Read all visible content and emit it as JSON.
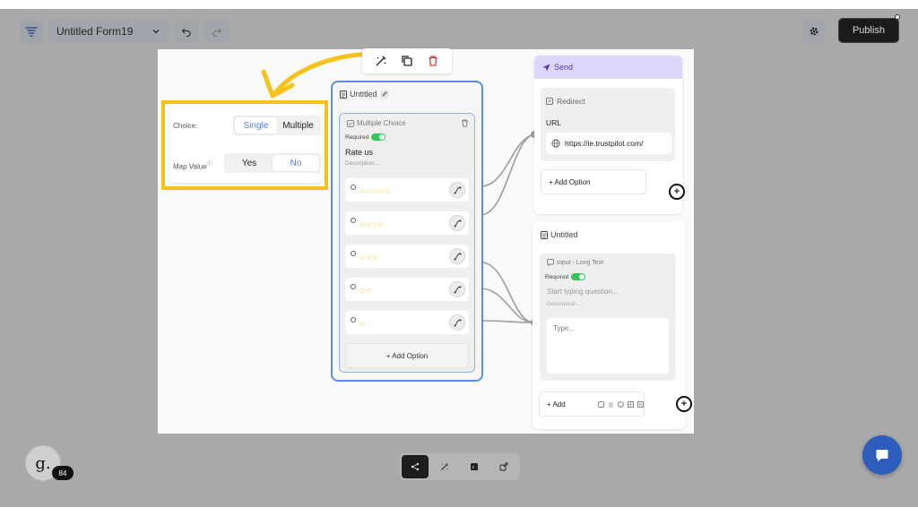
{
  "header": {
    "form_name": "Untitled Form19",
    "publish_label": "Publish"
  },
  "choice_panel": {
    "choice_label": "Choice:",
    "choice_options": [
      "Single",
      "Multiple"
    ],
    "choice_selected": "Single",
    "map_value_label": "Map Value",
    "map_options": [
      "Yes",
      "No"
    ],
    "map_selected": "No"
  },
  "main_node": {
    "title": "Untitled",
    "card_type": "Multiple Choice",
    "required_label": "Required",
    "question": "Rate us",
    "description_placeholder": "Description...",
    "options": [
      "☆☆☆☆☆",
      "☆☆☆☆",
      "☆☆☆",
      "☆☆",
      "☆"
    ],
    "add_option_label": "+ Add Option"
  },
  "send_node": {
    "title": "Send",
    "redirect_label": "Redirect",
    "url_label": "URL",
    "url_value": "https://ie.trustpilot.com/",
    "add_option_label": "+ Add Option"
  },
  "second_node": {
    "title": "Untitled",
    "card_type": "Input - Long Text",
    "required_label": "Required",
    "question_placeholder": "Start typing question...",
    "description_placeholder": "Description...",
    "answer_placeholder": "Type...",
    "add_label": "+ Add"
  },
  "user": {
    "avatar_letter": "g.",
    "badge_count": "84"
  },
  "colors": {
    "accent": "#5b8de6",
    "highlight": "#f5c21b",
    "send_header": "#dcd6fb",
    "toggle_on": "#34c759",
    "chat_button": "#2f5dbb"
  }
}
